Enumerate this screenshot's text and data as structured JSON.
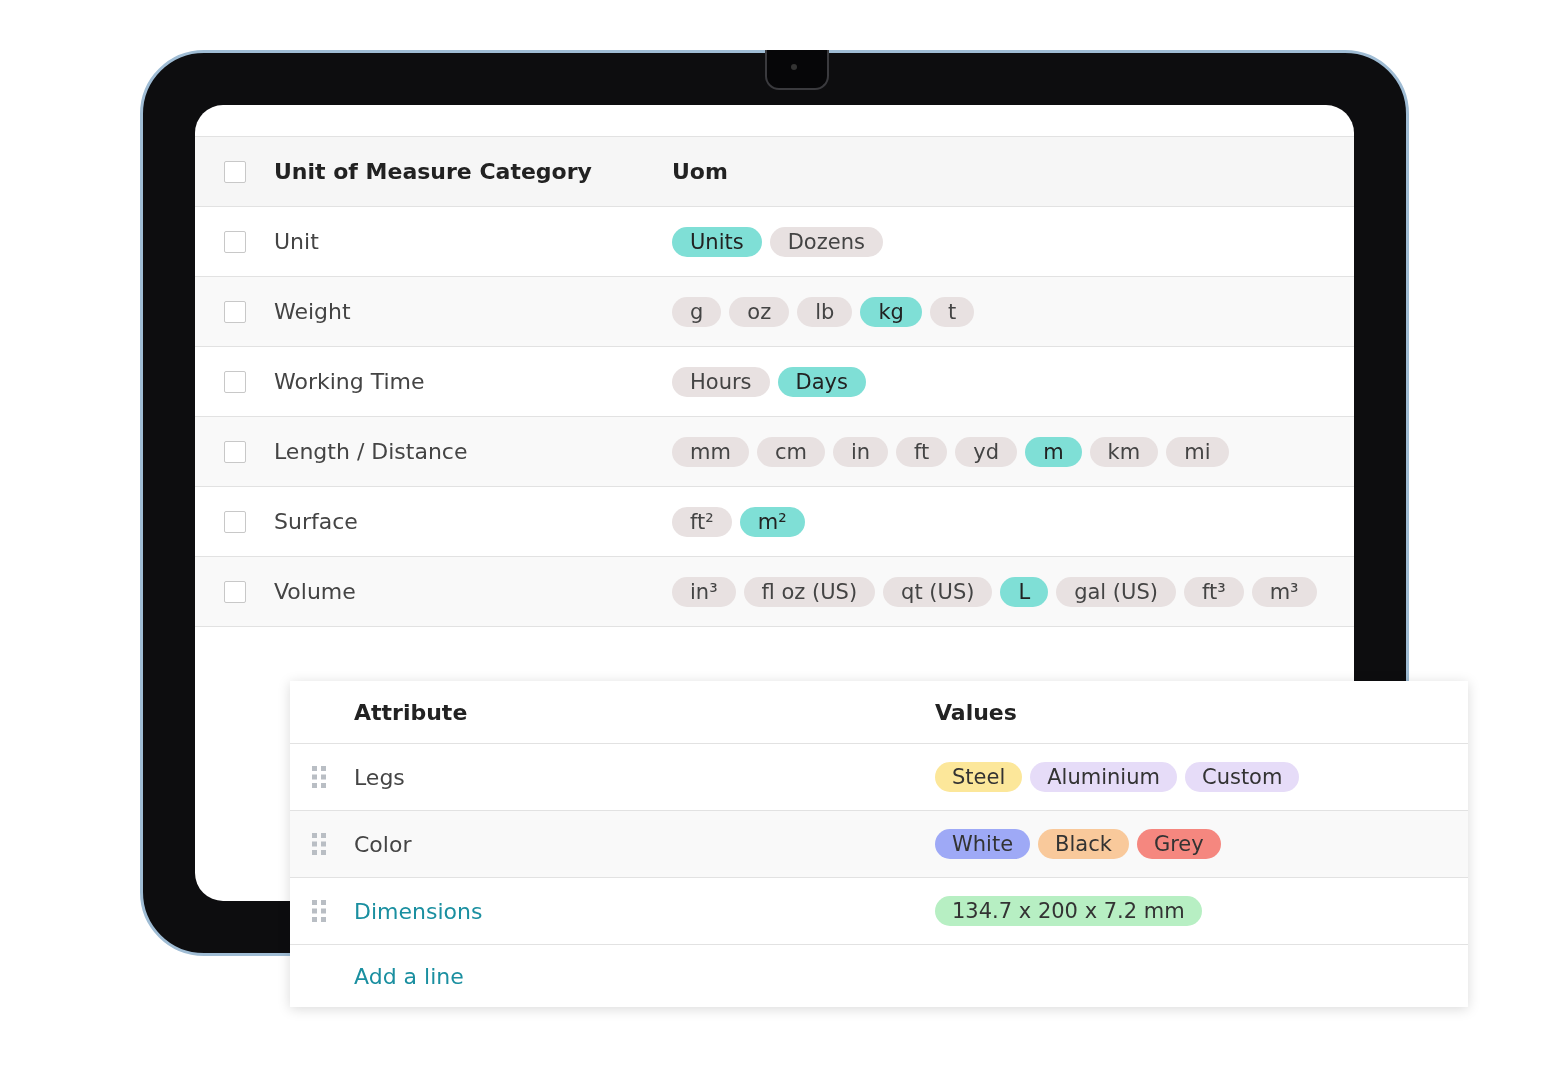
{
  "uom_table": {
    "columns": [
      "Unit of Measure Category",
      "Uom"
    ],
    "select_all_checked": false,
    "rows": [
      {
        "category": "Unit",
        "checked": false,
        "uoms": [
          {
            "label": "Units",
            "selected": true
          },
          {
            "label": "Dozens",
            "selected": false
          }
        ]
      },
      {
        "category": "Weight",
        "checked": false,
        "uoms": [
          {
            "label": "g",
            "selected": false
          },
          {
            "label": "oz",
            "selected": false
          },
          {
            "label": "lb",
            "selected": false
          },
          {
            "label": "kg",
            "selected": true
          },
          {
            "label": "t",
            "selected": false
          }
        ]
      },
      {
        "category": "Working Time",
        "checked": false,
        "uoms": [
          {
            "label": "Hours",
            "selected": false
          },
          {
            "label": "Days",
            "selected": true
          }
        ]
      },
      {
        "category": "Length / Distance",
        "checked": false,
        "uoms": [
          {
            "label": "mm",
            "selected": false
          },
          {
            "label": "cm",
            "selected": false
          },
          {
            "label": "in",
            "selected": false
          },
          {
            "label": "ft",
            "selected": false
          },
          {
            "label": "yd",
            "selected": false
          },
          {
            "label": "m",
            "selected": true
          },
          {
            "label": "km",
            "selected": false
          },
          {
            "label": "mi",
            "selected": false
          }
        ]
      },
      {
        "category": "Surface",
        "checked": false,
        "uoms": [
          {
            "label": "ft²",
            "selected": false
          },
          {
            "label": "m²",
            "selected": true
          }
        ]
      },
      {
        "category": "Volume",
        "checked": false,
        "uoms": [
          {
            "label": "in³",
            "selected": false
          },
          {
            "label": "fl oz (US)",
            "selected": false
          },
          {
            "label": "qt (US)",
            "selected": false
          },
          {
            "label": "L",
            "selected": true
          },
          {
            "label": "gal (US)",
            "selected": false
          },
          {
            "label": "ft³",
            "selected": false
          },
          {
            "label": "m³",
            "selected": false
          }
        ]
      }
    ]
  },
  "attribute_table": {
    "columns": [
      "Attribute",
      "Values"
    ],
    "rows": [
      {
        "attribute": "Legs",
        "link": false,
        "values": [
          {
            "label": "Steel",
            "color": "#fce79a"
          },
          {
            "label": "Aluminium",
            "color": "#e6dcf8"
          },
          {
            "label": "Custom",
            "color": "#e6dcf8"
          }
        ]
      },
      {
        "attribute": "Color",
        "link": false,
        "values": [
          {
            "label": "White",
            "color": "#9ea9f6"
          },
          {
            "label": "Black",
            "color": "#f9c99b"
          },
          {
            "label": "Grey",
            "color": "#f5877f"
          }
        ]
      },
      {
        "attribute": "Dimensions",
        "link": true,
        "values": [
          {
            "label": "134.7 x 200 x 7.2 mm",
            "color": "#b7efc3"
          }
        ]
      }
    ],
    "add_line": "Add a line"
  }
}
